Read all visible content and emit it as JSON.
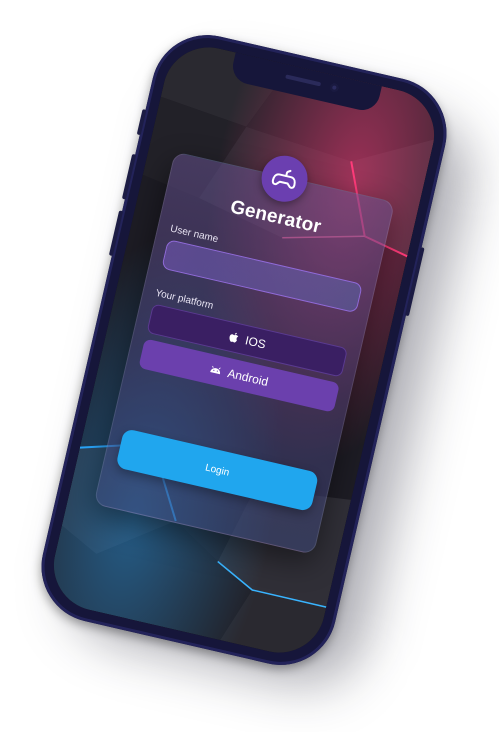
{
  "app": {
    "title": "Generator"
  },
  "form": {
    "username_label": "User name",
    "username_value": "",
    "platform_label": "Your platform",
    "platforms": [
      {
        "label": "IOS",
        "icon": "apple-icon",
        "selected": true
      },
      {
        "label": "Android",
        "icon": "android-icon",
        "selected": false
      }
    ],
    "login_label": "Login"
  },
  "icons": {
    "logo": "gamepad-icon"
  },
  "colors": {
    "frame": "#16163a",
    "accent": "#6b3fb0",
    "login": "#20a6ee",
    "ios_button": "#3a1f63",
    "android_button": "#6b40ad",
    "glow_top": "#ff3b7a",
    "glow_bottom": "#2aa8ff"
  }
}
